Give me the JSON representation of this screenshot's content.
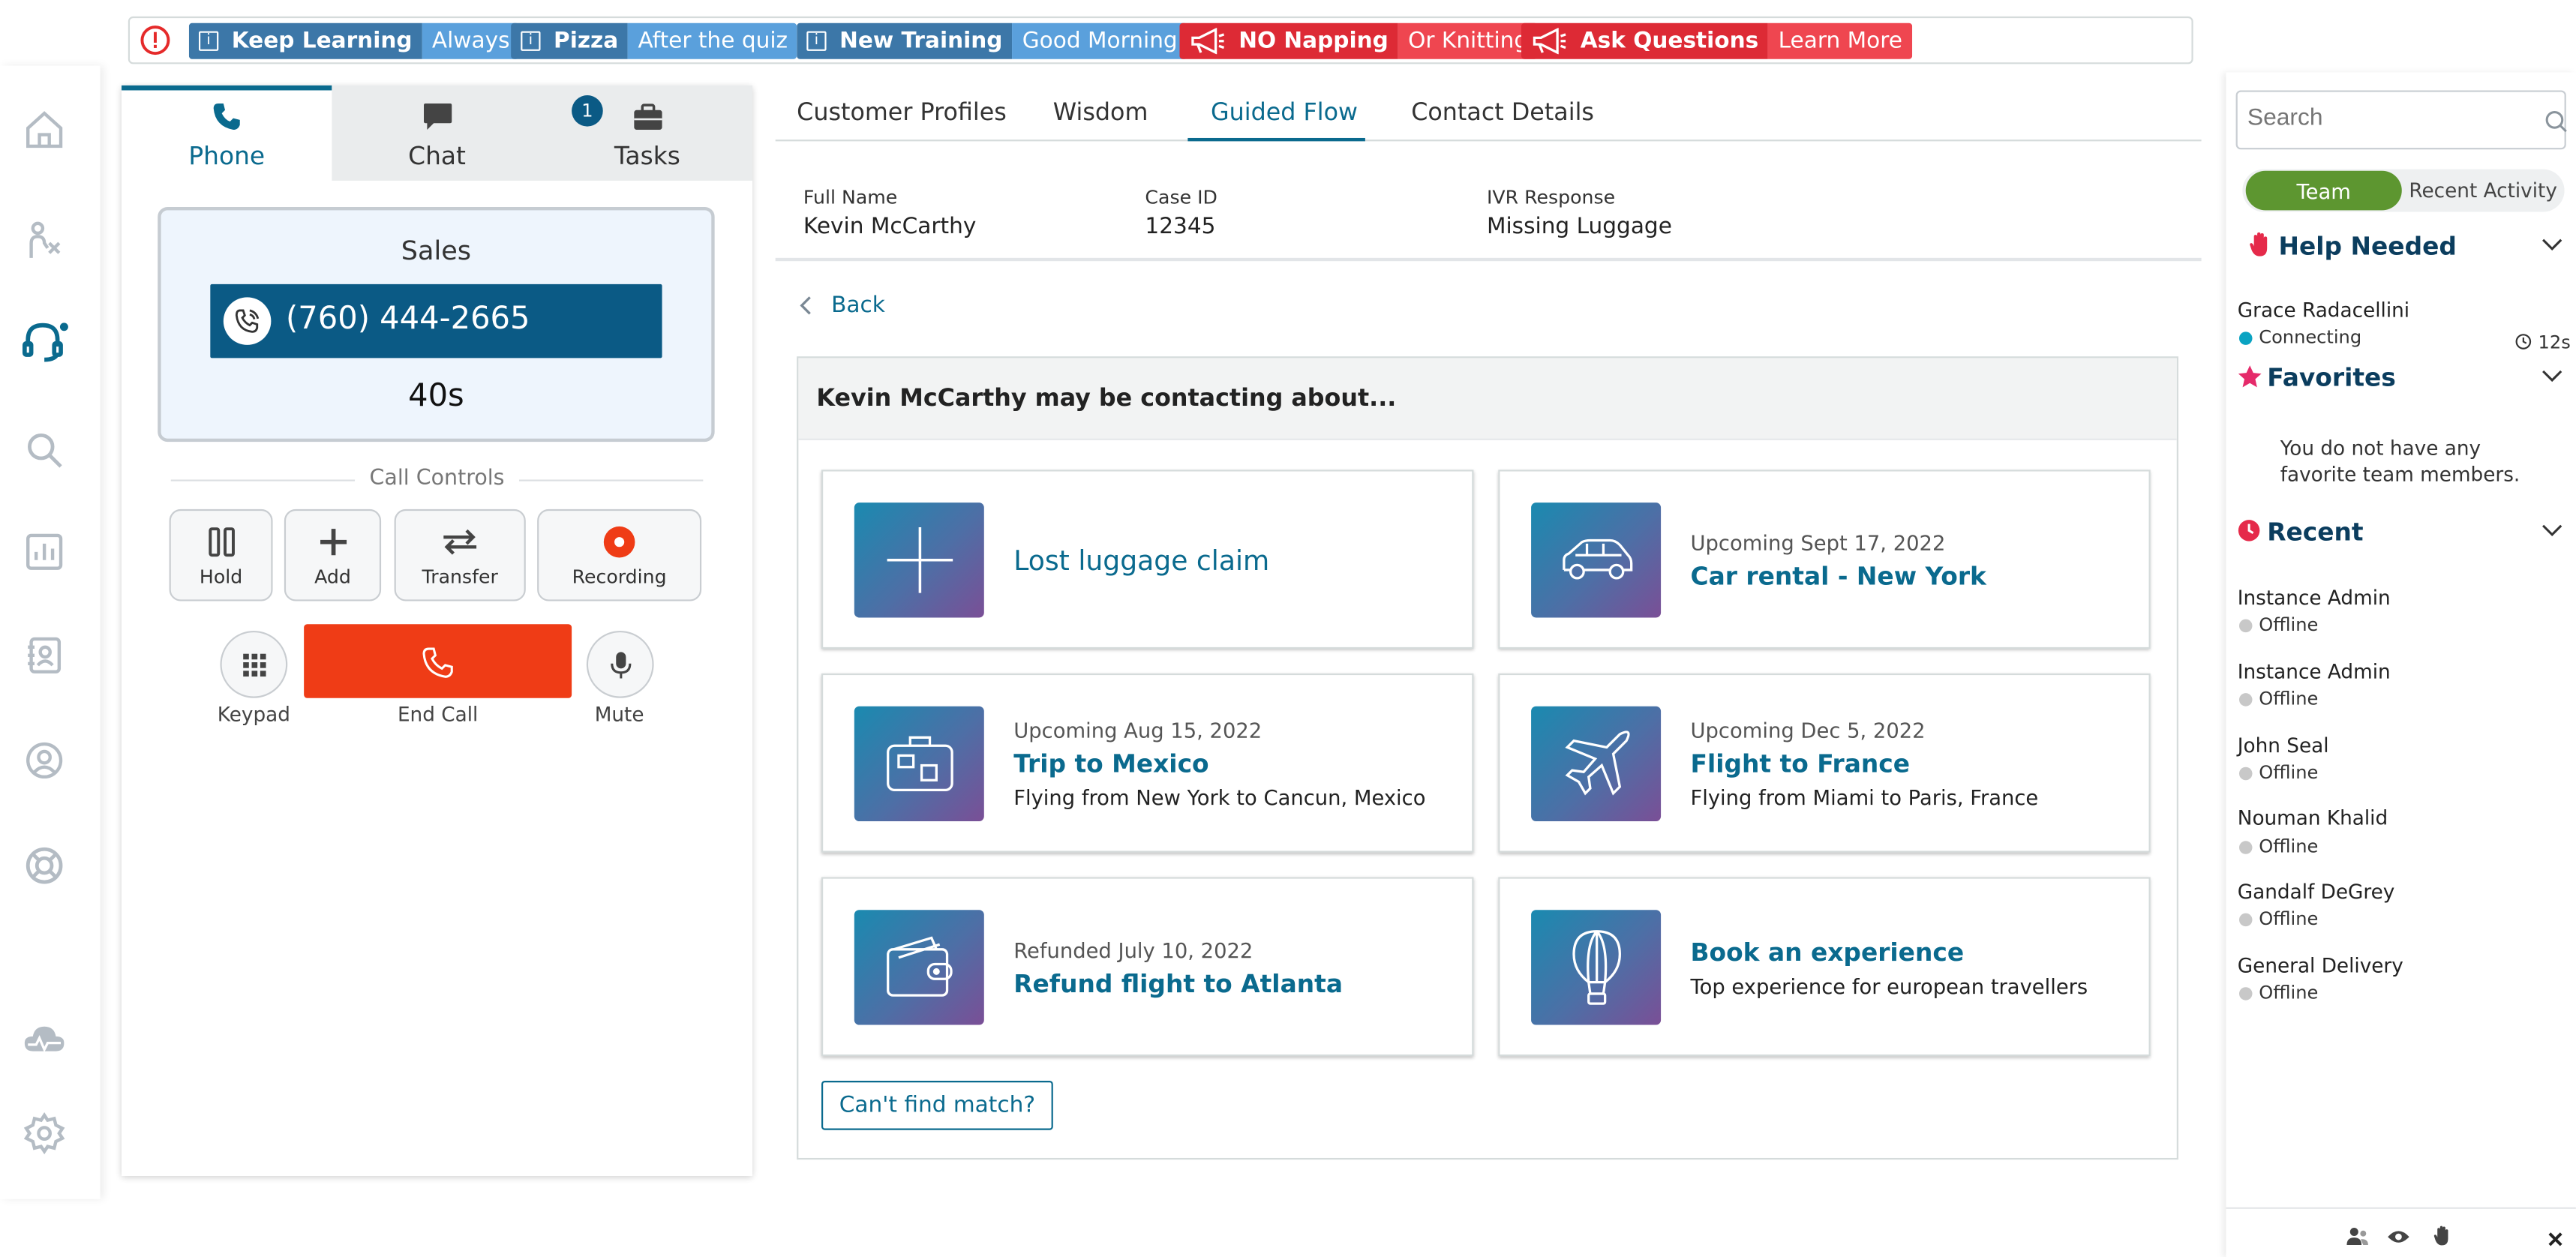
{
  "banner": {
    "chips": [
      {
        "key": "Keep Learning",
        "value": "Always",
        "type": "info"
      },
      {
        "key": "Pizza",
        "value": "After the quiz",
        "type": "info"
      },
      {
        "key": "New Training",
        "value": "Good Morning",
        "type": "info"
      },
      {
        "key": "NO Napping",
        "value": "Or Knitting",
        "type": "alert"
      },
      {
        "key": "Ask Questions",
        "value": "Learn More",
        "type": "alert"
      }
    ]
  },
  "ccp": {
    "tabs": {
      "phone": "Phone",
      "chat": "Chat",
      "tasks": "Tasks",
      "tasks_badge": "1"
    },
    "queue": "Sales",
    "phone_number": "(760) 444-2665",
    "duration": "40s",
    "call_controls_label": "Call Controls",
    "buttons": {
      "hold": "Hold",
      "add": "Add",
      "transfer": "Transfer",
      "recording": "Recording",
      "keypad": "Keypad",
      "end_call": "End Call",
      "mute": "Mute"
    }
  },
  "main": {
    "tabs": [
      "Customer Profiles",
      "Wisdom",
      "Guided Flow",
      "Contact Details"
    ],
    "active_tab": "Guided Flow",
    "attributes": [
      {
        "label": "Full Name",
        "value": "Kevin McCarthy"
      },
      {
        "label": "Case ID",
        "value": "12345"
      },
      {
        "label": "IVR Response",
        "value": "Missing Luggage"
      }
    ],
    "back": "Back",
    "heading": "Kevin McCarthy may be contacting about...",
    "cards": [
      {
        "icon": "plus-icon",
        "subtitle": "",
        "title": "Lost luggage claim",
        "desc": ""
      },
      {
        "icon": "car-icon",
        "subtitle": "Upcoming Sept 17, 2022",
        "title": "Car rental - New York",
        "desc": ""
      },
      {
        "icon": "suitcase-icon",
        "subtitle": "Upcoming Aug 15, 2022",
        "title": "Trip to Mexico",
        "desc": "Flying from New York to Cancun, Mexico"
      },
      {
        "icon": "airplane-icon",
        "subtitle": "Upcoming Dec 5, 2022",
        "title": "Flight to France",
        "desc": "Flying from Miami to Paris, France"
      },
      {
        "icon": "wallet-icon",
        "subtitle": "Refunded July 10, 2022",
        "title": "Refund flight to Atlanta",
        "desc": ""
      },
      {
        "icon": "balloon-icon",
        "subtitle": "",
        "title": "Book an experience",
        "desc": "Top experience for european travellers"
      }
    ],
    "cant_find": "Can't find match?"
  },
  "right": {
    "search_placeholder": "Search",
    "toggle": {
      "team": "Team",
      "recent": "Recent Activity"
    },
    "help_needed": "Help Needed",
    "help_person": {
      "name": "Grace Radacellini",
      "status": "Connecting",
      "time": "12s"
    },
    "favorites": "Favorites",
    "favorites_empty": "You do not have any favorite team members.",
    "recent": "Recent",
    "recent_people": [
      {
        "name": "Instance Admin",
        "status": "Offline"
      },
      {
        "name": "Instance Admin",
        "status": "Offline"
      },
      {
        "name": "John Seal",
        "status": "Offline"
      },
      {
        "name": "Nouman Khalid",
        "status": "Offline"
      },
      {
        "name": "Gandalf DeGrey",
        "status": "Offline"
      },
      {
        "name": "General Delivery",
        "status": "Offline"
      }
    ]
  },
  "colors": {
    "accent": "#0a6a8e",
    "end_call": "#ef3c16",
    "team_toggle": "#5d9630",
    "alert_red": "#dd2a35",
    "info_blue": "#3c77a8"
  }
}
